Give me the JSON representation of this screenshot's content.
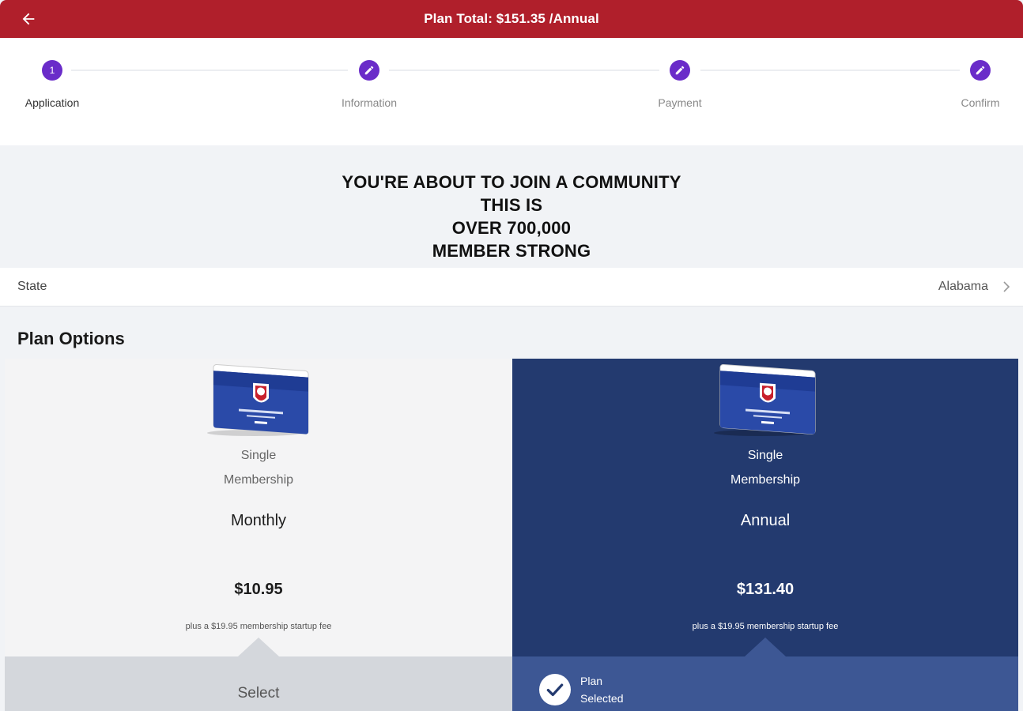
{
  "header": {
    "title": "Plan Total: $151.35 /Annual"
  },
  "stepper": {
    "steps": [
      {
        "label": "Application",
        "number": "1",
        "state": "current"
      },
      {
        "label": "Information",
        "state": "edit"
      },
      {
        "label": "Payment",
        "state": "edit"
      },
      {
        "label": "Confirm",
        "state": "edit"
      }
    ]
  },
  "hero": {
    "lines": [
      "YOU'RE ABOUT TO JOIN A COMMUNITY",
      "THIS IS",
      "OVER 700,000",
      "MEMBER STRONG"
    ]
  },
  "state_field": {
    "label": "State",
    "value": "Alabama"
  },
  "plan_options": {
    "title": "Plan Options",
    "plans": [
      {
        "line1": "Single",
        "line2": "Membership",
        "period": "Monthly",
        "price": "$10.95",
        "fee": "plus a $19.95 membership startup fee",
        "action_label": "Select",
        "selected": false
      },
      {
        "line1": "Single",
        "line2": "Membership",
        "period": "Annual",
        "price": "$131.40",
        "fee": "plus a $19.95 membership startup fee",
        "selected_label_1": "Plan",
        "selected_label_2": "Selected",
        "selected": true
      }
    ]
  },
  "colors": {
    "header": "#b01f2b",
    "step_accent": "#6a2cc9",
    "selected_card": "#233a6f",
    "selected_footer": "#3d5794"
  },
  "icons": {
    "back": "arrow-left-icon",
    "step_edit": "pencil-icon",
    "chevron": "chevron-right-icon",
    "check": "check-icon"
  }
}
